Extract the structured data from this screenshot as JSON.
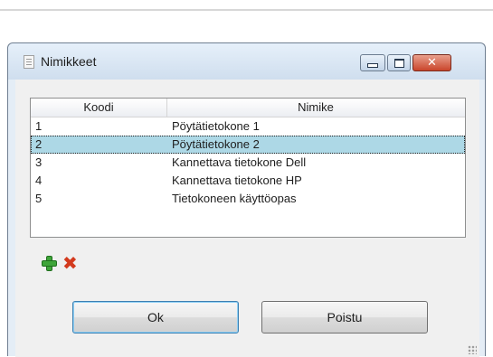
{
  "window": {
    "title": "Nimikkeet"
  },
  "title_controls": {
    "minimize": "–",
    "maximize": "□",
    "close": "✕"
  },
  "grid": {
    "columns": [
      "Koodi",
      "Nimike"
    ],
    "rows": [
      {
        "code": "1",
        "name": "Pöytätietokone 1",
        "selected": false
      },
      {
        "code": "2",
        "name": "Pöytätietokone 2",
        "selected": true
      },
      {
        "code": "3",
        "name": "Kannettava tietokone Dell",
        "selected": false
      },
      {
        "code": "4",
        "name": "Kannettava tietokone HP",
        "selected": false
      },
      {
        "code": "5",
        "name": "Tietokoneen käyttöopas",
        "selected": false
      }
    ]
  },
  "actions": {
    "add_icon": "plus-icon",
    "delete_icon": "delete-icon",
    "delete_glyph": "✖"
  },
  "buttons": {
    "ok": "Ok",
    "cancel": "Poistu"
  },
  "colors": {
    "selection": "#add8e6",
    "add": "#3fa53a",
    "delete": "#d33a1e",
    "close": "#c9452b"
  }
}
